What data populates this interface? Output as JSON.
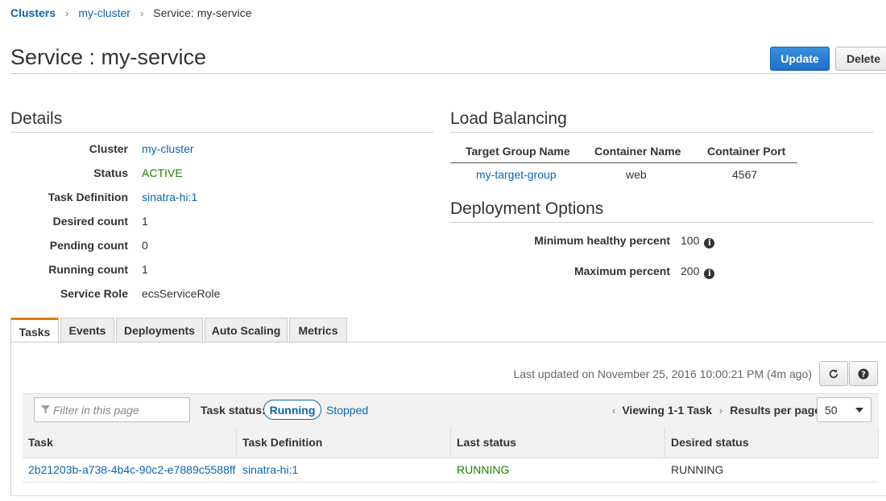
{
  "breadcrumb": {
    "root": "Clusters",
    "cluster": "my-cluster",
    "current": "Service: my-service"
  },
  "page_title": "Service : my-service",
  "actions": {
    "update": "Update",
    "delete": "Delete"
  },
  "details": {
    "title": "Details",
    "rows": [
      {
        "label": "Cluster",
        "value": "my-cluster"
      },
      {
        "label": "Status",
        "value": "ACTIVE"
      },
      {
        "label": "Task Definition",
        "value": "sinatra-hi:1"
      },
      {
        "label": "Desired count",
        "value": "1"
      },
      {
        "label": "Pending count",
        "value": "0"
      },
      {
        "label": "Running count",
        "value": "1"
      },
      {
        "label": "Service Role",
        "value": "ecsServiceRole"
      }
    ]
  },
  "load_balancing": {
    "title": "Load Balancing",
    "headers": [
      "Target Group Name",
      "Container Name",
      "Container Port"
    ],
    "row": [
      "my-target-group",
      "web",
      "4567"
    ]
  },
  "deployment_options": {
    "title": "Deployment Options",
    "rows": [
      {
        "label": "Minimum healthy percent",
        "value": "100"
      },
      {
        "label": "Maximum percent",
        "value": "200"
      }
    ],
    "info_glyph": "i"
  },
  "tabs": [
    "Tasks",
    "Events",
    "Deployments",
    "Auto Scaling",
    "Metrics"
  ],
  "tasks_panel": {
    "last_updated": "Last updated on November 25, 2016 10:00:21 PM (4m ago)",
    "filter_placeholder": "Filter in this page",
    "task_status_label": "Task status:",
    "status_running": "Running",
    "status_stopped": "Stopped",
    "viewing": "Viewing 1-1 Task",
    "results_per_page_label": "Results per page",
    "results_per_page_value": "50",
    "columns": [
      "Task",
      "Task Definition",
      "Last status",
      "Desired status"
    ],
    "rows": [
      {
        "task": "2b21203b-a738-4b4c-90c2-e7889c5588ff",
        "task_definition": "sinatra-hi:1",
        "last_status": "RUNNING",
        "desired_status": "RUNNING"
      }
    ]
  },
  "colors": {
    "link": "#0a66b0",
    "active_green": "#1d8102",
    "primary_button": "#1c6fc8",
    "active_tab_accent": "#e07b0d"
  },
  "icons": {
    "breadcrumb_separator": "chevron-right-icon",
    "refresh": "refresh-icon",
    "help": "help-icon",
    "filter": "filter-icon",
    "info": "info-icon",
    "dropdown": "caret-down-icon",
    "pager_prev": "chevron-left-icon",
    "pager_next": "chevron-right-icon"
  }
}
